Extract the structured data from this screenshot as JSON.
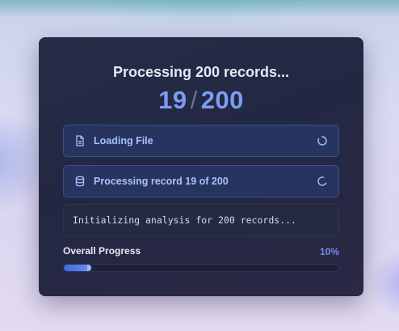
{
  "dialog": {
    "title": "Processing 200 records...",
    "counter_current": "19",
    "counter_separator": "/",
    "counter_total": "200"
  },
  "steps": [
    {
      "label": "Loading File",
      "icon": "file-icon",
      "status": "loading"
    },
    {
      "label": "Processing record 19 of 200",
      "icon": "database-icon",
      "status": "loading"
    }
  ],
  "log": {
    "message": "Initializing analysis for 200 records..."
  },
  "progress": {
    "label": "Overall Progress",
    "percent_text": "10%",
    "value": 0.1
  },
  "colors": {
    "accent": "#7d9cf5",
    "card_bg": "#252a45",
    "step_bg": "#26345f",
    "step_text": "#a9c0ff"
  }
}
